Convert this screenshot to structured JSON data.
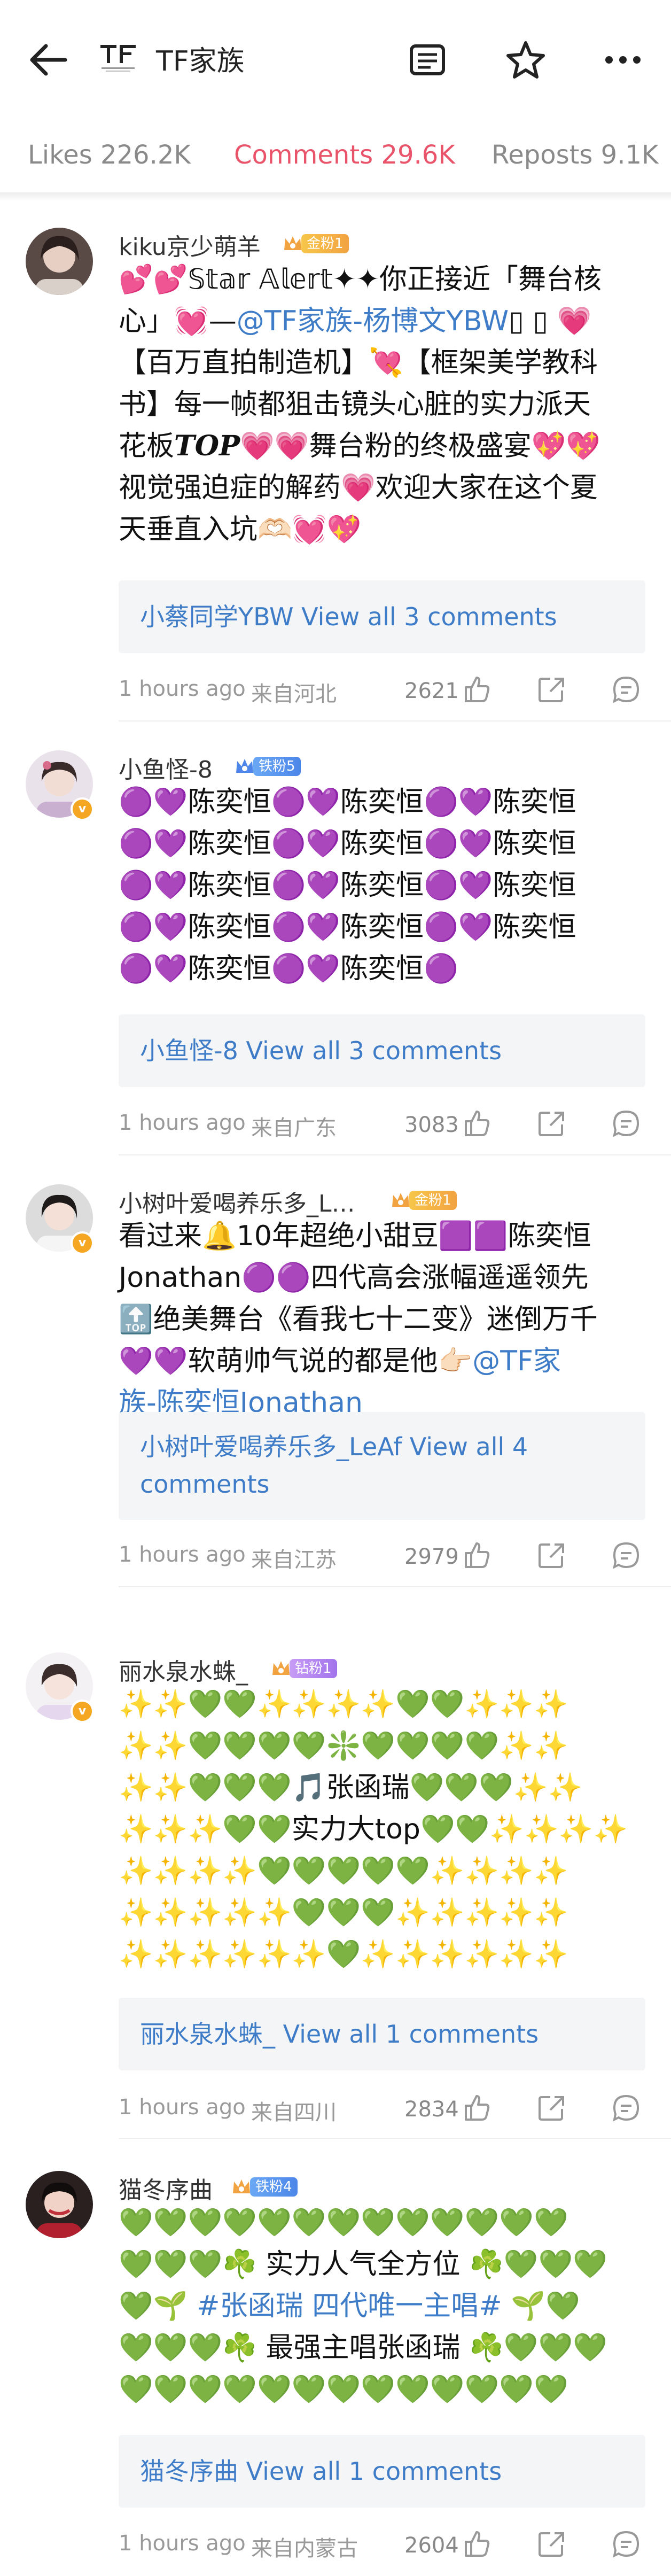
{
  "header": {
    "title": "TF家族",
    "icons": [
      "back-arrow-icon",
      "tf-logo",
      "menu-icon",
      "star-icon",
      "more-icon"
    ]
  },
  "tabs": [
    {
      "label": "Likes 226.2K",
      "active": false
    },
    {
      "label": "Comments 29.6K",
      "active": true
    },
    {
      "label": "Reposts 9.1K",
      "active": false
    }
  ],
  "comments": [
    {
      "username": "kiku京少萌羊",
      "badge": "金粉1",
      "lines": [
        "💕💕𝕊𝕥𝕒𝕣 𝔸𝕝𝕖𝕣𝕥✦✦你正接近「舞台核",
        "心」💓—@TF家族-杨博文YBW",
        "【百万直拍制造机】💘【框架美学教科",
        "书】每一帧都狙击镜头心脏的实力派天",
        "花板TOP💗💗舞台粉的终极盛宴💖💖",
        "视觉强迫症的解药💗欢迎大家在这个夏",
        "天垂直入坑🫶🏻💓💖"
      ],
      "mention": "@TF家族-杨博文YBW",
      "line2_tail": "▯ ▯ 💗",
      "line4_bold": "TOP",
      "reply": "小蔡同学YBW View all 3 comments",
      "time": "1 hours ago",
      "location": "来自河北",
      "likes": "2621"
    },
    {
      "username": "小鱼怪-8",
      "badge": "铁粉5",
      "lines": [
        "🟣💜陈奕恒🟣💜陈奕恒🟣💜陈奕恒",
        "🟣💜陈奕恒🟣💜陈奕恒🟣💜陈奕恒",
        "🟣💜陈奕恒🟣💜陈奕恒🟣💜陈奕恒",
        "🟣💜陈奕恒🟣💜陈奕恒🟣💜陈奕恒",
        "🟣💜陈奕恒🟣💜陈奕恒🟣"
      ],
      "reply": "小鱼怪-8 View all 3 comments",
      "time": "1 hours ago",
      "location": "来自广东",
      "likes": "3083"
    },
    {
      "username": "小树叶爱喝养乐多_L…",
      "badge": "金粉1",
      "lines": [
        "看过来🔔10年超绝小甜豆🟪🟪陈奕恒",
        "Jonathan🟣🟣四代高会涨幅遥遥领先",
        "🔝绝美舞台《看我七十二变》迷倒万千",
        "💜💜软萌帅气说的都是他👉🏻@TF家",
        "族-陈奕恒Jonathan"
      ],
      "mention_a": "@TF家",
      "mention_b": "族-陈奕恒Jonathan",
      "reply_lines": [
        "小树叶爱喝养乐多_LeAf View all 4",
        "comments"
      ],
      "time": "1 hours ago",
      "location": "来自江苏",
      "likes": "2979"
    },
    {
      "username": "丽水泉水蛛_",
      "badge": "钻粉1",
      "lines": [
        "✨✨💚💚✨✨✨✨💚💚✨✨✨",
        "✨✨💚💚💚💚❇️💚💚💚💚✨✨",
        "✨✨💚💚💚🎵张函瑞💚💚💚✨✨",
        "✨✨✨💚💚实力大top💚💚✨✨✨✨",
        "✨✨✨✨💚💚💚💚💚✨✨✨✨",
        "✨✨✨✨✨💚💚💚✨✨✨✨✨",
        "✨✨✨✨✨✨💚✨✨✨✨✨✨"
      ],
      "reply": "丽水泉水蛛_ View all 1 comments",
      "time": "1 hours ago",
      "location": "来自四川",
      "likes": "2834"
    },
    {
      "username": "猫冬序曲",
      "badge": "铁粉4",
      "lines": [
        "💚💚💚💚💚💚💚💚💚💚💚💚💚",
        "💚💚💚☘️ 实力人气全方位 ☘️💚💚💚",
        "💚🌱 #张函瑞 四代唯一主唱# 🌱💚",
        "💚💚💚☘️ 最强主唱张函瑞 ☘️💚💚💚",
        "💚💚💚💚💚💚💚💚💚💚💚💚💚"
      ],
      "hashtag": "#张函瑞 四代唯一主唱#",
      "reply": "猫冬序曲 View all 1 comments",
      "time": "1 hours ago",
      "location": "来自内蒙古",
      "likes": "2604"
    }
  ]
}
